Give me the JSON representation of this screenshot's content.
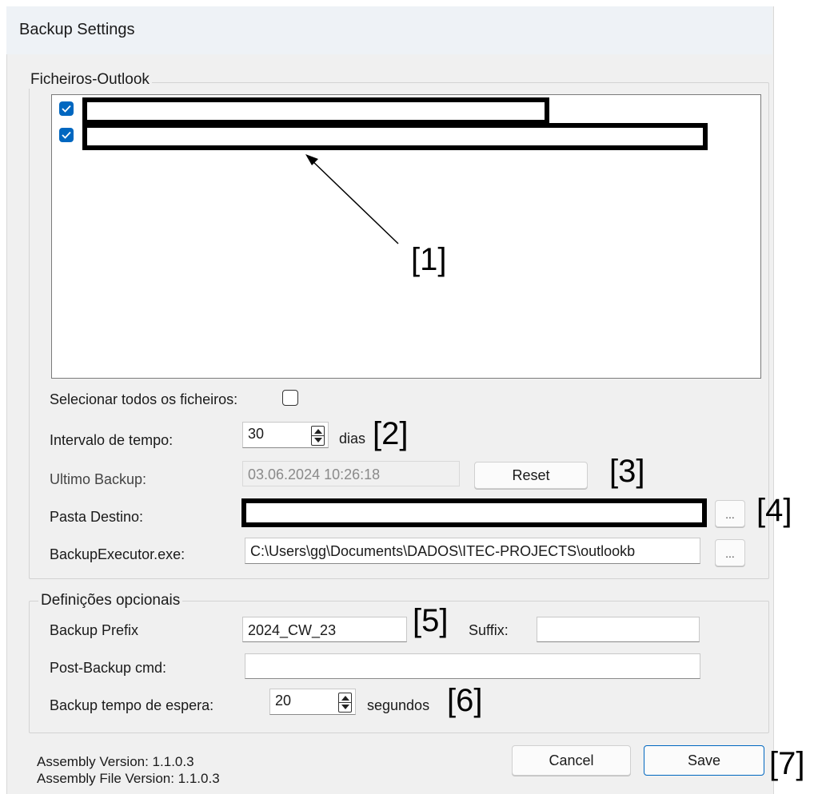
{
  "window": {
    "title": "Backup Settings"
  },
  "files_group": {
    "legend": "Ficheiros-Outlook",
    "items": [
      {
        "checked": true
      },
      {
        "checked": true
      }
    ]
  },
  "select_all": {
    "label": "Selecionar todos os ficheiros:",
    "checked": false
  },
  "interval": {
    "label": "Intervalo de tempo:",
    "value": "30",
    "unit": "dias"
  },
  "last_backup": {
    "label": "Ultimo Backup:",
    "value": "03.06.2024 10:26:18",
    "reset_label": "Reset"
  },
  "destination": {
    "label": "Pasta Destino:",
    "browse_label": "..."
  },
  "executor": {
    "label": "BackupExecutor.exe:",
    "value": "C:\\Users\\gg\\Documents\\DADOS\\ITEC-PROJECTS\\outlookb",
    "browse_label": "..."
  },
  "optional": {
    "legend": "Definições opcionais",
    "prefix_label": "Backup Prefix",
    "prefix_value": "2024_CW_23",
    "suffix_label": "Suffix:",
    "suffix_value": "",
    "post_cmd_label": "Post-Backup cmd:",
    "post_cmd_value": "",
    "wait_label": "Backup tempo de espera:",
    "wait_value": "20",
    "wait_unit": "segundos"
  },
  "footer": {
    "assembly_version": "Assembly Version: 1.1.0.3",
    "assembly_file_version": "Assembly File Version: 1.1.0.3",
    "cancel_label": "Cancel",
    "save_label": "Save"
  },
  "annotations": [
    "[1]",
    "[2]",
    "[3]",
    "[4]",
    "[5]",
    "[6]",
    "[7]"
  ]
}
